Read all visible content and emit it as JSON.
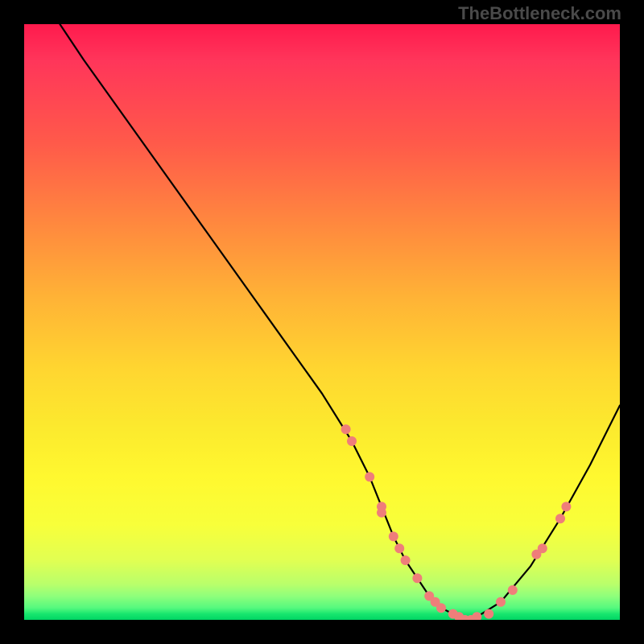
{
  "watermark": "TheBottleneck.com",
  "chart_data": {
    "type": "line",
    "title": "",
    "xlabel": "",
    "ylabel": "",
    "xlim": [
      0,
      100
    ],
    "ylim": [
      0,
      100
    ],
    "grid": false,
    "legend": false,
    "series": [
      {
        "name": "curve",
        "color": "#000000",
        "x": [
          6,
          10,
          20,
          30,
          40,
          50,
          55,
          58,
          60,
          62,
          64,
          66,
          68,
          70,
          72,
          74,
          76,
          80,
          85,
          90,
          95,
          100
        ],
        "y": [
          100,
          94,
          80,
          66,
          52,
          38,
          30,
          24,
          19,
          14,
          10,
          7,
          4,
          2,
          1,
          0,
          0.5,
          3,
          9,
          17,
          26,
          36
        ]
      }
    ],
    "markers": [
      {
        "name": "dots",
        "color": "#ef7e7a",
        "radius": 6,
        "x": [
          54,
          55,
          58,
          60,
          60,
          62,
          63,
          64,
          66,
          68,
          69,
          70,
          72,
          73,
          74,
          75,
          76,
          78,
          80,
          82,
          86,
          87,
          90,
          91
        ],
        "y": [
          32,
          30,
          24,
          19,
          18,
          14,
          12,
          10,
          7,
          4,
          3,
          2,
          1,
          0.5,
          0,
          0,
          0.5,
          1,
          3,
          5,
          11,
          12,
          17,
          19
        ]
      }
    ],
    "gradient": {
      "stops": [
        {
          "pct": 0,
          "color": "#ff1a4d"
        },
        {
          "pct": 20,
          "color": "#ff5a4a"
        },
        {
          "pct": 46,
          "color": "#ffb336"
        },
        {
          "pct": 68,
          "color": "#fcea2e"
        },
        {
          "pct": 90,
          "color": "#e1ff52"
        },
        {
          "pct": 98,
          "color": "#55f97e"
        },
        {
          "pct": 100,
          "color": "#00d564"
        }
      ]
    }
  }
}
